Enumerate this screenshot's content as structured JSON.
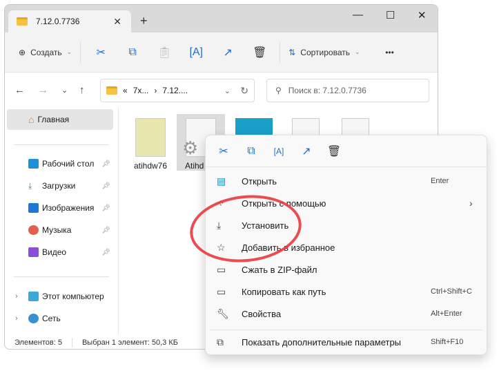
{
  "window": {
    "tab_title": "7.12.0.7736",
    "close_tab": "✕",
    "new_tab": "+",
    "minimize": "—",
    "maximize": "☐",
    "close": "✕"
  },
  "toolbar": {
    "create_label": "Создать",
    "sort_label": "Сортировать",
    "more": "•••"
  },
  "address": {
    "crumb_overflow": "«",
    "crumb1": "7x...",
    "sep": "›",
    "crumb2": "7.12....",
    "search_placeholder": "Поиск в: 7.12.0.7736"
  },
  "sidebar": {
    "home": "Главная",
    "items": [
      {
        "label": "Рабочий стол",
        "color": "#1e90d8"
      },
      {
        "label": "Загрузки",
        "color": "#1aa36b"
      },
      {
        "label": "Изображения",
        "color": "#1c78d4"
      },
      {
        "label": "Музыка",
        "color": "#e0604a"
      },
      {
        "label": "Видео",
        "color": "#8a4fd8"
      }
    ],
    "this_pc": "Этот компьютер",
    "network": "Сеть"
  },
  "files": [
    {
      "name": "atihdw76"
    },
    {
      "name": "Atihd"
    }
  ],
  "status": {
    "count": "Элементов: 5",
    "selected": "Выбран 1 элемент: 50,3 КБ"
  },
  "context_menu": {
    "items": [
      {
        "label": "Открыть",
        "shortcut": "Enter",
        "icon": "notepad-icon"
      },
      {
        "label": "Открыть с помощью",
        "shortcut": "›",
        "icon": "open-with-icon"
      },
      {
        "label": "Установить",
        "shortcut": "",
        "icon": "install-icon"
      },
      {
        "label": "Добавить в избранное",
        "shortcut": "",
        "icon": "star-icon"
      },
      {
        "label": "Сжать в ZIP-файл",
        "shortcut": "",
        "icon": "zip-icon"
      },
      {
        "label": "Копировать как путь",
        "shortcut": "Ctrl+Shift+C",
        "icon": "copy-path-icon"
      },
      {
        "label": "Свойства",
        "shortcut": "Alt+Enter",
        "icon": "wrench-icon"
      }
    ],
    "more": {
      "label": "Показать дополнительные параметры",
      "shortcut": "Shift+F10"
    }
  },
  "highlight_color": "#e8383d"
}
